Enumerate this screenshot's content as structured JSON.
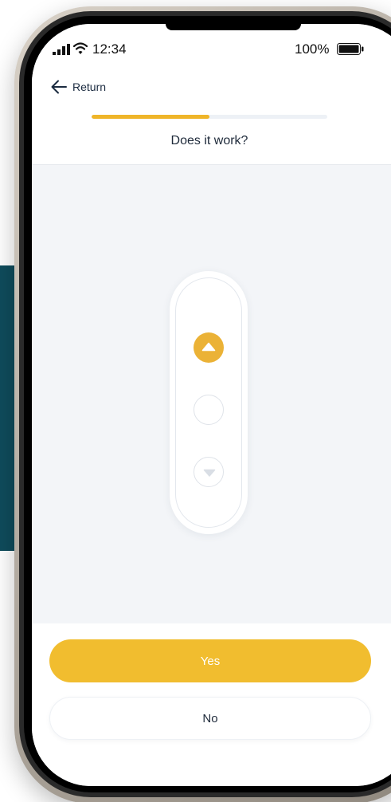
{
  "status_bar": {
    "time": "12:34",
    "battery_percent": "100%",
    "icons": [
      "signal-icon",
      "wifi-icon",
      "battery-icon"
    ]
  },
  "navigation": {
    "back_label": "Return",
    "back_icon": "arrow-left-icon"
  },
  "progress": {
    "fraction": 0.5
  },
  "question": {
    "title": "Does it work?"
  },
  "remote": {
    "buttons": [
      {
        "icon": "triangle-up-icon",
        "state": "active"
      },
      {
        "icon": "circle-stop-icon",
        "state": "idle"
      },
      {
        "icon": "triangle-down-icon",
        "state": "idle"
      }
    ]
  },
  "actions": {
    "yes_label": "Yes",
    "no_label": "No"
  },
  "colors": {
    "accent": "#f1bd2f",
    "accent_dark": "#ebb236",
    "text": "#1e2a3a",
    "background": "#f3f5f8",
    "teal": "#0f4c5c"
  }
}
